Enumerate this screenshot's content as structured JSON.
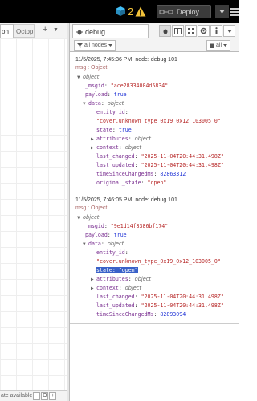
{
  "header": {
    "alert_count": "2",
    "deploy_label": "Deploy"
  },
  "left": {
    "tabs": [
      {
        "label": "on"
      },
      {
        "label": "Octop"
      }
    ],
    "add_symbol": "+",
    "menu_symbol": "▼",
    "footer_text": "ate available",
    "zoom_out": "−",
    "zoom_reset": "O",
    "zoom_in": "+"
  },
  "sidebar": {
    "tab_label": "debug",
    "filter_label": "all nodes",
    "clear_label": "all"
  },
  "messages": [
    {
      "timestamp": "11/5/2025, 7:45:36 PM",
      "node": "node: debug 101",
      "topic": "msg : Object",
      "root": "object",
      "msgid_key": "_msgid",
      "msgid_val": "\"ace28334004d5834\"",
      "payload_key": "payload",
      "payload_val": "true",
      "data_key": "data",
      "data_type": "object",
      "entity_key": "entity_id",
      "entity_val": "\"cover.unknown_type_0x19_0x12_103005_0\"",
      "state_key": "state",
      "state_val": "true",
      "attributes_key": "attributes",
      "attributes_type": "object",
      "context_key": "context",
      "context_type": "object",
      "last_changed_key": "last_changed",
      "last_changed_val": "\"2025-11-04T20:44:31.498Z\"",
      "last_updated_key": "last_updated",
      "last_updated_val": "\"2025-11-04T20:44:31.498Z\"",
      "tsc_key": "timeSinceChangedMs",
      "tsc_val": "82863312",
      "orig_key": "original_state",
      "orig_val": "\"open\""
    },
    {
      "timestamp": "11/5/2025, 7:46:05 PM",
      "node": "node: debug 101",
      "topic": "msg : Object",
      "root": "object",
      "msgid_key": "_msgid",
      "msgid_val": "\"9e1d14f8386bf174\"",
      "payload_key": "payload",
      "payload_val": "true",
      "data_key": "data",
      "data_type": "object",
      "entity_key": "entity_id",
      "entity_val": "\"cover.unknown_type_0x19_0x12_103005_0\"",
      "state_key": "state",
      "state_val": "\"open\"",
      "attributes_key": "attributes",
      "attributes_type": "object",
      "context_key": "context",
      "context_type": "object",
      "last_changed_key": "last_changed",
      "last_changed_val": "\"2025-11-04T20:44:31.498Z\"",
      "last_updated_key": "last_updated",
      "last_updated_val": "\"2025-11-04T20:44:31.498Z\"",
      "tsc_key": "timeSinceChangedMs",
      "tsc_val": "82893094"
    }
  ],
  "colors": {
    "header_bg": "#000000",
    "alert_yellow": "#f2c23a",
    "key_purple": "#792e90",
    "string_red": "#b72828",
    "number_blue": "#2033d6",
    "selection_blue": "#3a61c8"
  },
  "icons": [
    "cube-icon",
    "warning-icon",
    "deploy-icon",
    "caret-down-icon",
    "hamburger-icon",
    "bug-icon",
    "book-icon",
    "grid-icon",
    "gear-icon",
    "info-icon",
    "filter-icon",
    "trash-icon"
  ]
}
